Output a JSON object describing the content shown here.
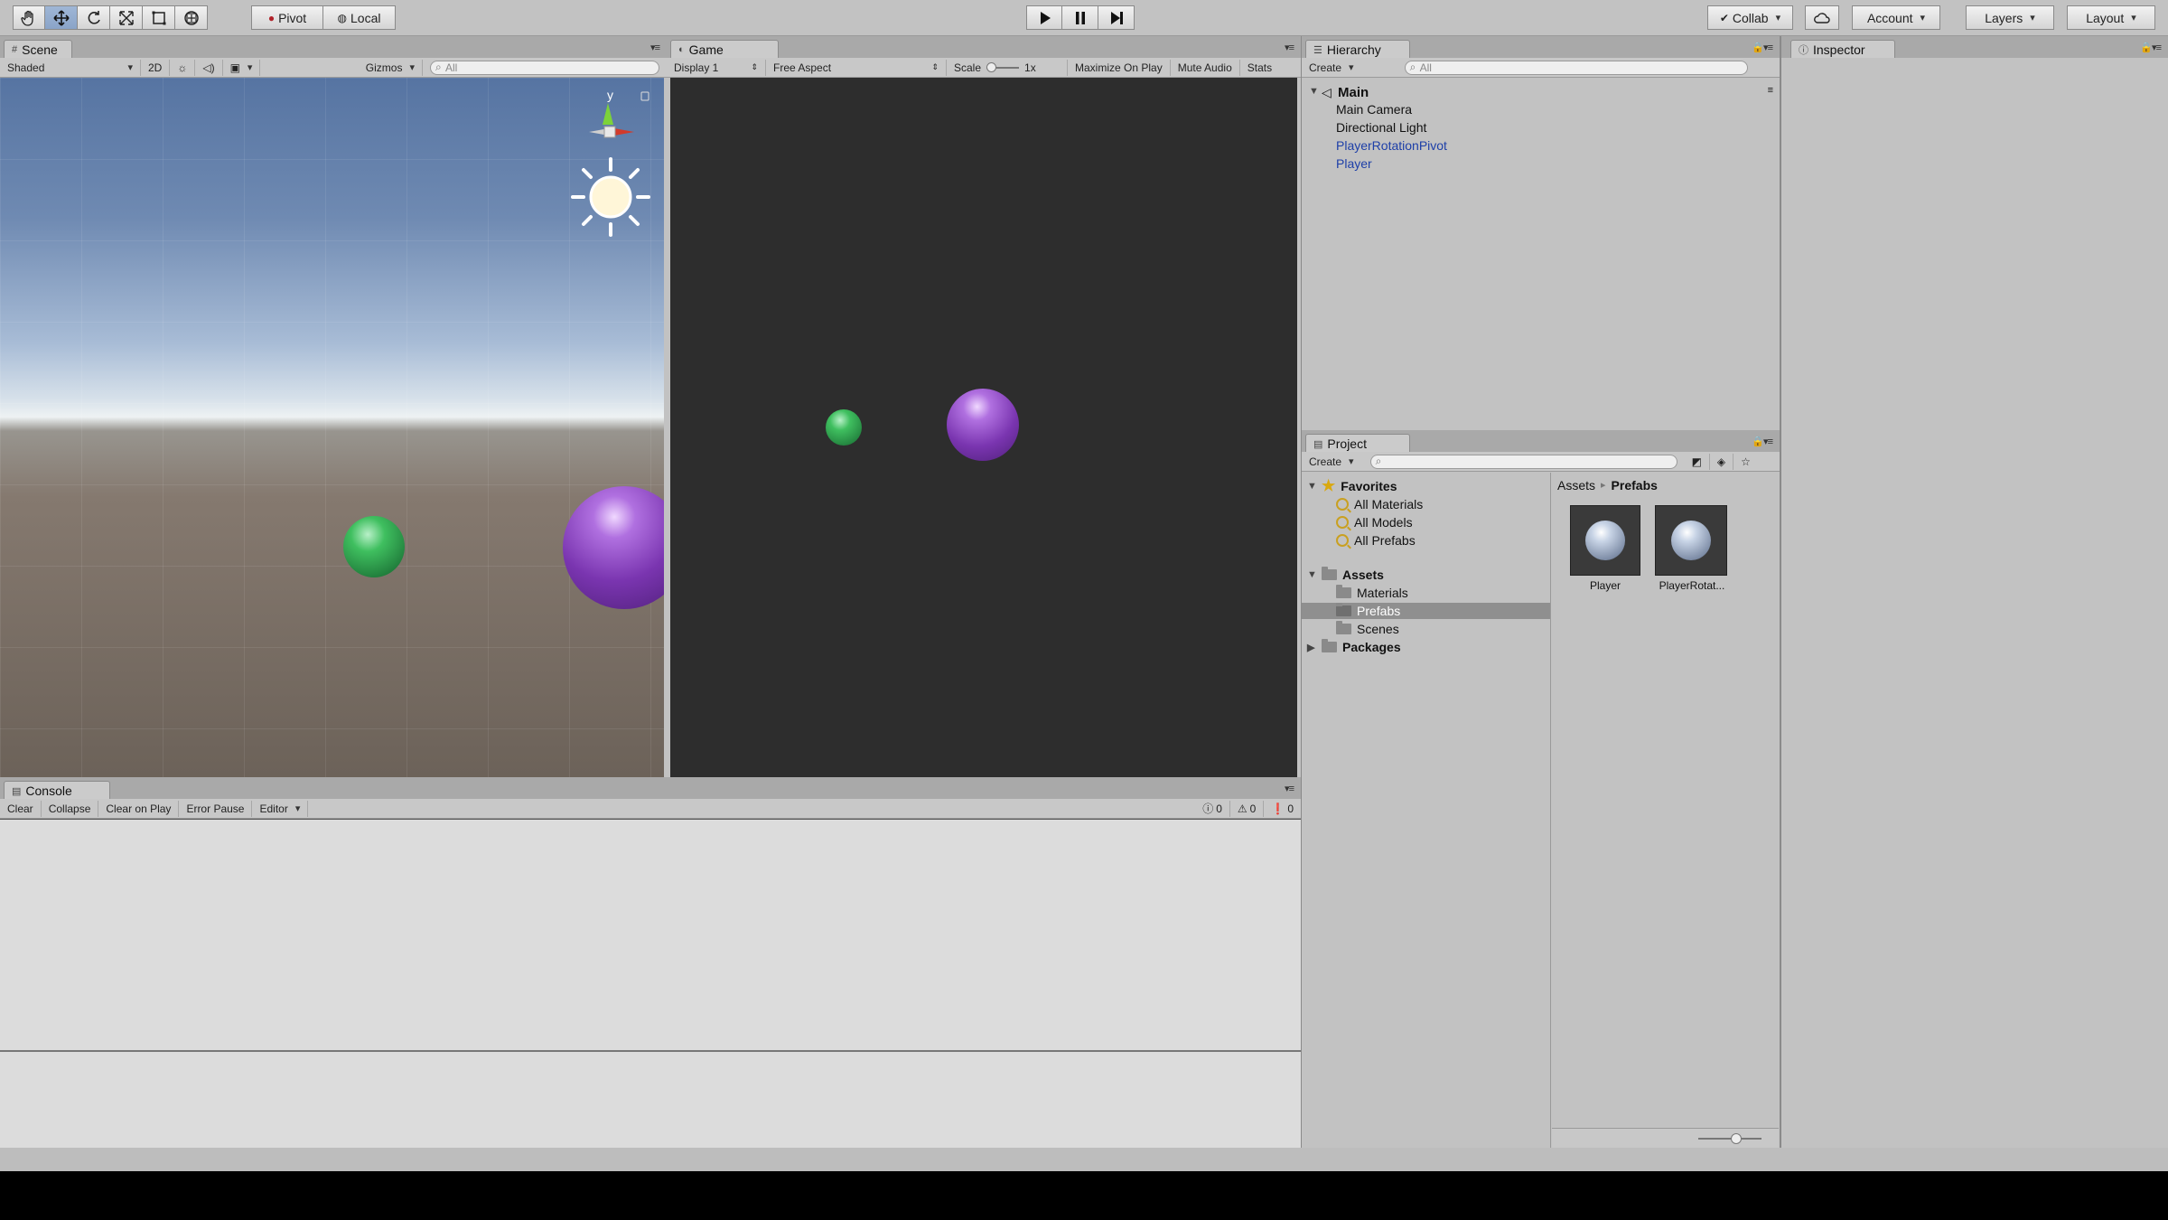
{
  "toolbar": {
    "pivot_label": "Pivot",
    "local_label": "Local",
    "collab_label": "Collab",
    "account_label": "Account",
    "layers_label": "Layers",
    "layout_label": "Layout"
  },
  "scene": {
    "tab_label": "Scene",
    "shading_mode": "Shaded",
    "mode_2d": "2D",
    "gizmos_label": "Gizmos",
    "search_placeholder": "All",
    "gizmo_axis_y": "y"
  },
  "game": {
    "tab_label": "Game",
    "display": "Display 1",
    "aspect": "Free Aspect",
    "scale_label": "Scale",
    "scale_value": "1x",
    "maximize_label": "Maximize On Play",
    "mute_label": "Mute Audio",
    "stats_label": "Stats"
  },
  "hierarchy": {
    "tab_label": "Hierarchy",
    "create_label": "Create",
    "search_placeholder": "All",
    "scene_name": "Main",
    "items": [
      {
        "label": "Main Camera",
        "prefab": false
      },
      {
        "label": "Directional Light",
        "prefab": false
      },
      {
        "label": "PlayerRotationPivot",
        "prefab": true
      },
      {
        "label": "Player",
        "prefab": true
      }
    ]
  },
  "project": {
    "tab_label": "Project",
    "create_label": "Create",
    "favorites_label": "Favorites",
    "favorites": [
      "All Materials",
      "All Models",
      "All Prefabs"
    ],
    "assets_label": "Assets",
    "asset_folders": [
      "Materials",
      "Prefabs",
      "Scenes"
    ],
    "selected_folder": "Prefabs",
    "packages_label": "Packages",
    "breadcrumb_root": "Assets",
    "breadcrumb_current": "Prefabs",
    "breadcrumb_sep": "▸",
    "grid_items": [
      "Player",
      "PlayerRotat..."
    ]
  },
  "inspector": {
    "tab_label": "Inspector"
  },
  "console": {
    "tab_label": "Console",
    "clear_label": "Clear",
    "collapse_label": "Collapse",
    "clear_on_play_label": "Clear on Play",
    "error_pause_label": "Error Pause",
    "editor_label": "Editor",
    "info_count": "0",
    "warning_count": "0",
    "error_count": "0"
  },
  "colors": {
    "accent_selected": "#8aa4c8",
    "prefab_text": "#1d3fa8",
    "sphere_green": "#3fbf5f",
    "sphere_purple": "#8a3fc0",
    "game_background": "#2d2d2d"
  }
}
